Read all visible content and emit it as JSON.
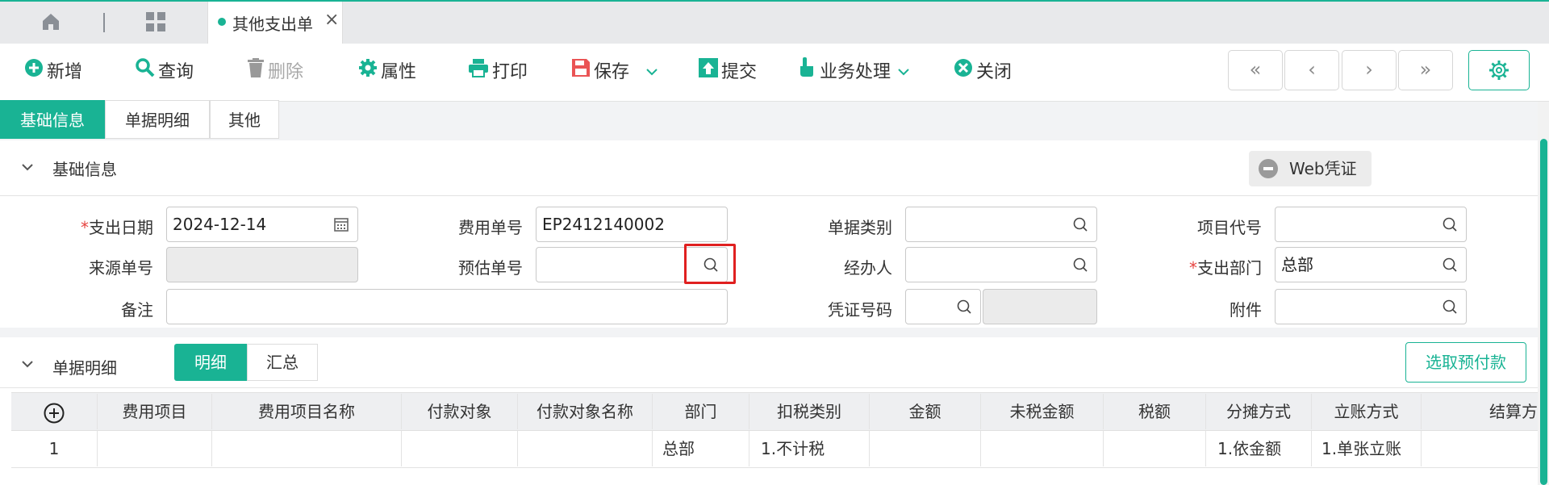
{
  "window": {
    "tab_title": "其他支出单",
    "accent": "#19b394"
  },
  "toolbar": {
    "add": "新增",
    "query": "查询",
    "delete": "删除",
    "properties": "属性",
    "print": "打印",
    "save": "保存",
    "submit": "提交",
    "business": "业务处理",
    "close": "关闭"
  },
  "nav": {
    "first": "«",
    "prev": "‹",
    "next": "›",
    "last": "»"
  },
  "form_tabs": [
    "基础信息",
    "单据明细",
    "其他"
  ],
  "basic": {
    "section_title": "基础信息",
    "web_voucher": "Web凭证",
    "fields": {
      "expense_date_label": "支出日期",
      "expense_date_value": "2024-12-14",
      "expense_no_label": "费用单号",
      "expense_no_value": "EP2412140002",
      "doc_type_label": "单据类别",
      "project_code_label": "项目代号",
      "source_no_label": "来源单号",
      "estimate_no_label": "预估单号",
      "handler_label": "经办人",
      "dept_label": "支出部门",
      "dept_value": "总部",
      "remark_label": "备注",
      "voucher_no_label": "凭证号码",
      "attachment_label": "附件"
    }
  },
  "detail": {
    "section_title": "单据明细",
    "toggle": [
      "明细",
      "汇总"
    ],
    "pick_prepay": "选取预付款",
    "columns": [
      "费用项目",
      "费用项目名称",
      "付款对象",
      "付款对象名称",
      "部门",
      "扣税类别",
      "金额",
      "未税金额",
      "税额",
      "分摊方式",
      "立账方式",
      "结算方"
    ],
    "rows": [
      {
        "no": "1",
        "dept": "总部",
        "tax_type": "1.不计税",
        "alloc": "1.依金额",
        "account": "1.单张立账"
      }
    ]
  }
}
